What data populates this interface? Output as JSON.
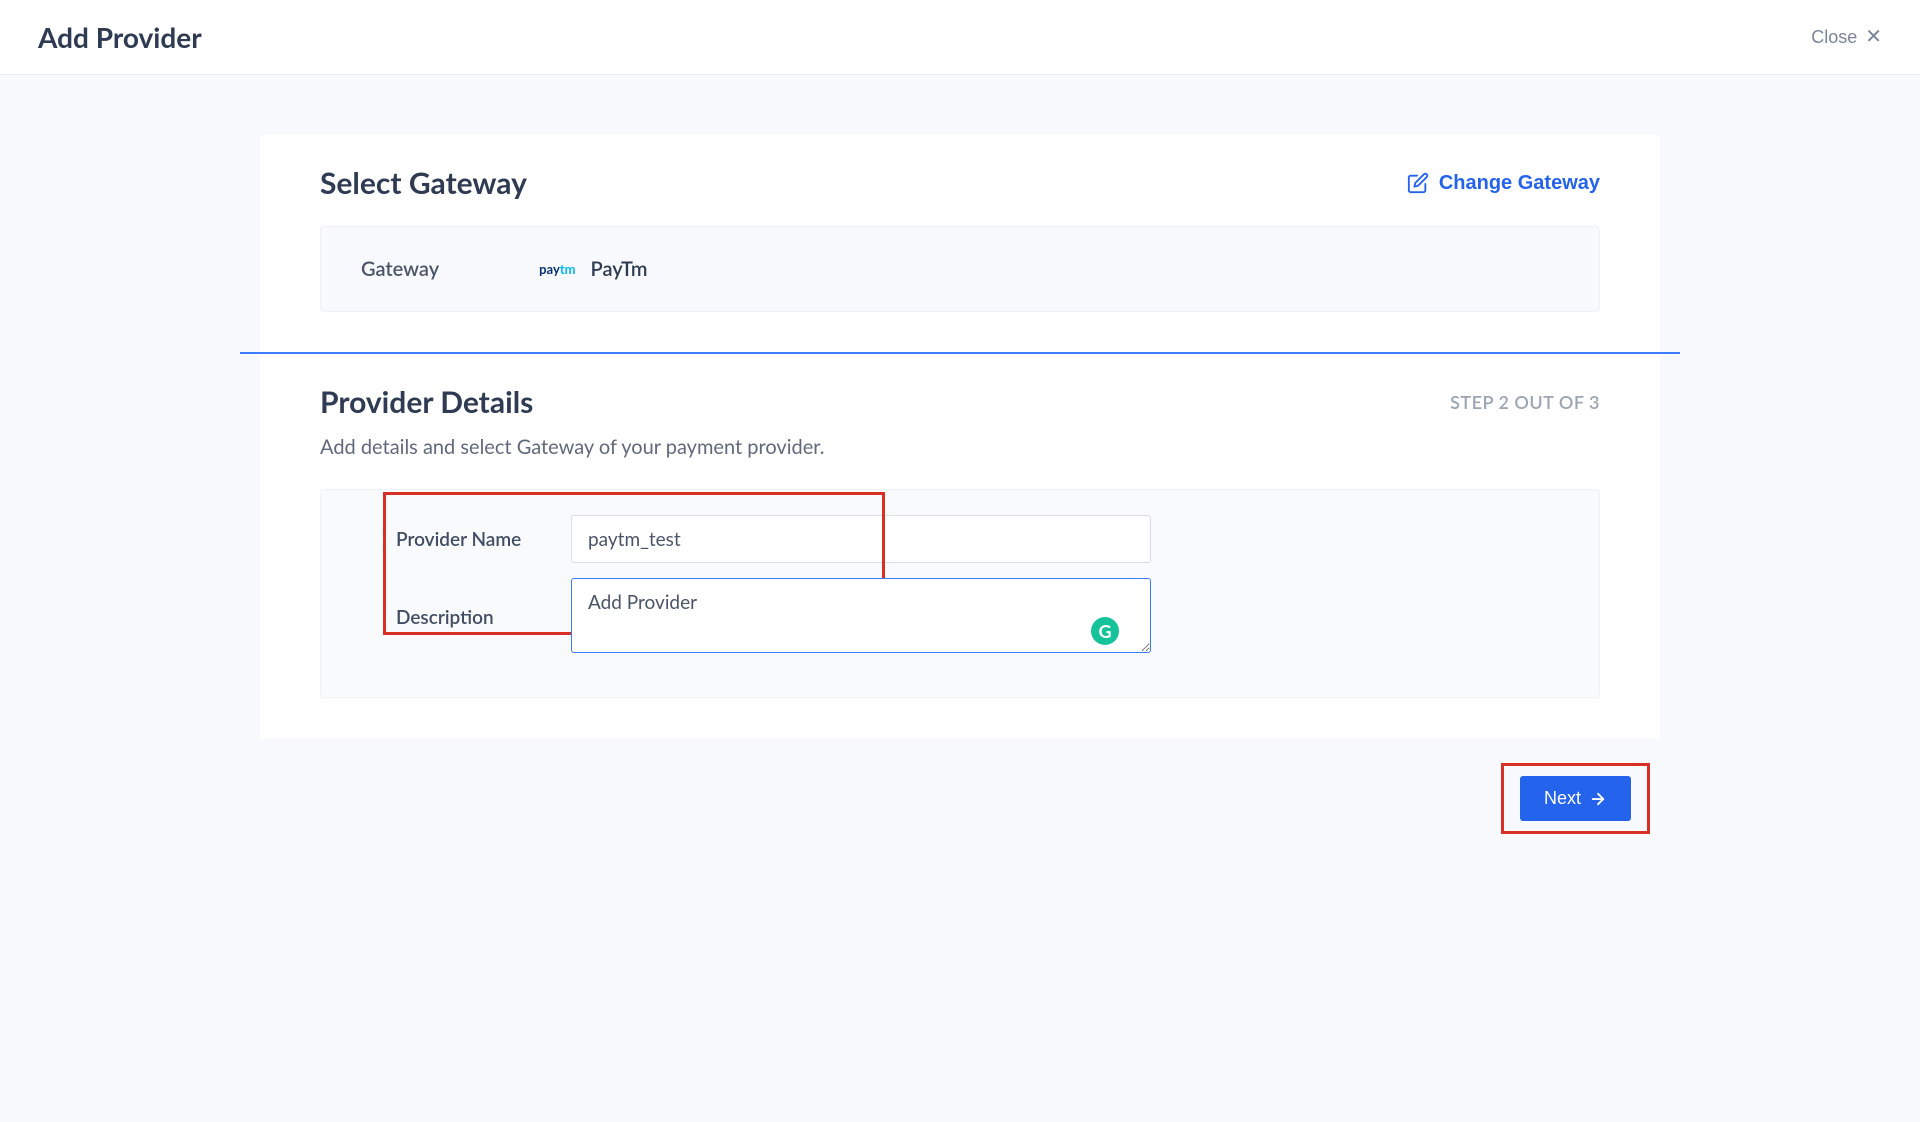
{
  "header": {
    "title": "Add Provider",
    "close_label": "Close"
  },
  "gateway_section": {
    "title": "Select Gateway",
    "change_label": "Change Gateway",
    "gateway_label": "Gateway",
    "gateway_logo_pay": "pay",
    "gateway_logo_tm": "tm",
    "gateway_name": "PayTm"
  },
  "details_section": {
    "title": "Provider Details",
    "step": "STEP 2 OUT OF 3",
    "subtitle": "Add details and select Gateway of your payment provider.",
    "provider_name_label": "Provider Name",
    "provider_name_value": "paytm_test",
    "description_label": "Description",
    "description_value": "Add Provider"
  },
  "actions": {
    "next_label": "Next"
  }
}
